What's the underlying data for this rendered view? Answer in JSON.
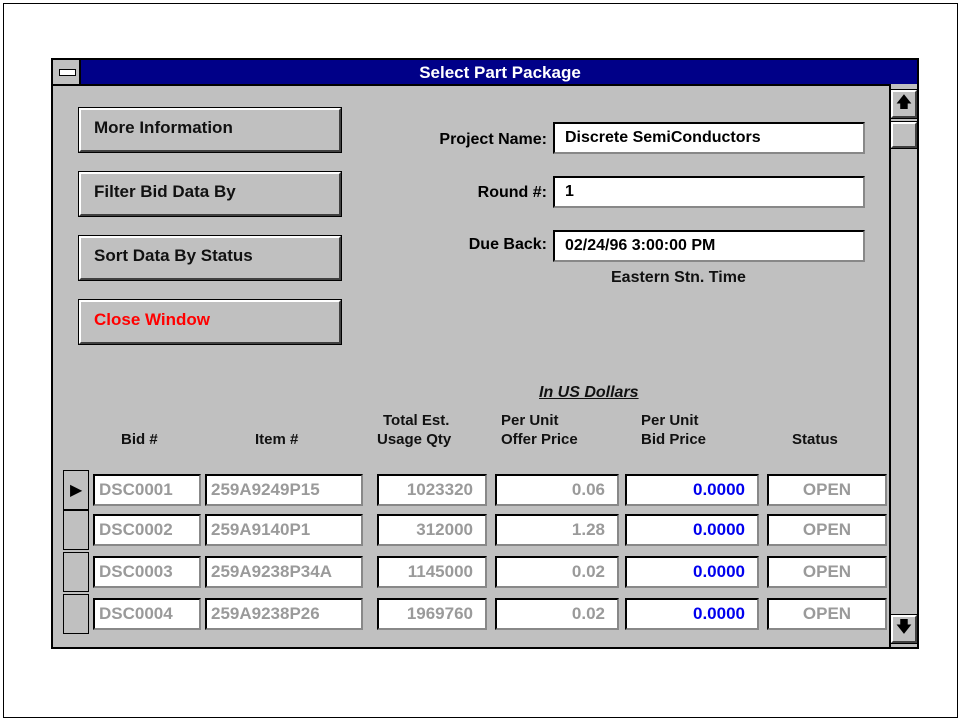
{
  "window": {
    "title": "Select Part Package"
  },
  "buttons": {
    "more_info": "More Information",
    "filter": "Filter Bid Data By",
    "sort": "Sort Data By Status",
    "close": "Close Window"
  },
  "form": {
    "project_label": "Project Name:",
    "project_value": "Discrete SemiConductors",
    "round_label": "Round #:",
    "round_value": "1",
    "due_label": "Due Back:",
    "due_value": "02/24/96  3:00:00 PM",
    "timezone_note": "Eastern Stn. Time"
  },
  "grid": {
    "currency_note": "In US Dollars",
    "headers": {
      "bid": "Bid #",
      "item": "Item #",
      "usage_1": "Total Est.",
      "usage_2": "Usage Qty",
      "offer_1": "Per Unit",
      "offer_2": "Offer Price",
      "bidprice_1": "Per Unit",
      "bidprice_2": "Bid Price",
      "status": "Status"
    },
    "current_row_marker": "▶",
    "rows": [
      {
        "bid": "DSC0001",
        "item": "259A9249P15",
        "qty": "1023320",
        "offer": "0.06",
        "bid_price": "0.0000",
        "status": "OPEN"
      },
      {
        "bid": "DSC0002",
        "item": "259A9140P1",
        "qty": "312000",
        "offer": "1.28",
        "bid_price": "0.0000",
        "status": "OPEN"
      },
      {
        "bid": "DSC0003",
        "item": "259A9238P34A",
        "qty": "1145000",
        "offer": "0.02",
        "bid_price": "0.0000",
        "status": "OPEN"
      },
      {
        "bid": "DSC0004",
        "item": "259A9238P26",
        "qty": "1969760",
        "offer": "0.02",
        "bid_price": "0.0000",
        "status": "OPEN"
      }
    ]
  },
  "scrollbar": {
    "up_icon": "up-arrow-icon",
    "down_icon": "down-arrow-icon"
  }
}
